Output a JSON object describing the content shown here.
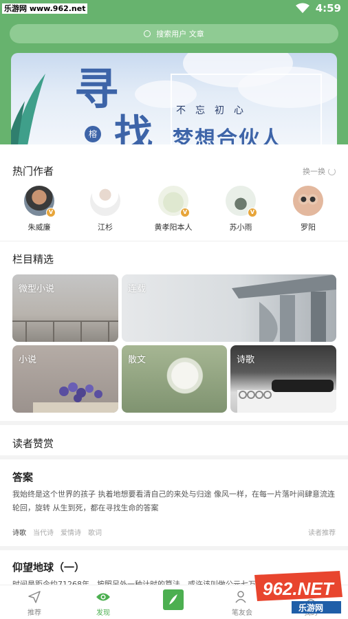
{
  "status_bar": {
    "site_label": "乐游网 www.962.net",
    "time": "4:59"
  },
  "search": {
    "placeholder": "搜索用户 文章"
  },
  "banner": {
    "big_char_1": "寻",
    "big_char_2": "找",
    "small_text": "不忘初心",
    "main_text": "梦想合伙人",
    "badge": "榕"
  },
  "hot_authors": {
    "title": "热门作者",
    "refresh_label": "换一换",
    "authors": [
      {
        "name": "朱威廉",
        "verified": true
      },
      {
        "name": "江杉",
        "verified": false
      },
      {
        "name": "黄孝阳本人",
        "verified": true
      },
      {
        "name": "苏小雨",
        "verified": true
      },
      {
        "name": "罗阳",
        "verified": false
      }
    ]
  },
  "columns": {
    "title": "栏目精选",
    "tiles": [
      {
        "label": "微型小说"
      },
      {
        "label": "连载"
      },
      {
        "label": "小说"
      },
      {
        "label": "散文"
      },
      {
        "label": "诗歌"
      }
    ]
  },
  "reader_appreciation": {
    "title": "读者赞赏"
  },
  "articles": [
    {
      "title": "答案",
      "body": "我始终是这个世界的孩子 执着地想要看清自己的来处与归途 像风一样，在每一片落叶间肆意流连 轮回，旋转 从生到死，都在寻找生命的答案",
      "tags": [
        "诗歌",
        "当代诗",
        "爱情诗",
        "歌词"
      ],
      "recommend": "读者推荐"
    },
    {
      "title": "仰望地球（一）",
      "body": "时间是距今约71268年，按照另外一种计时的算法，或许该叫做公元七万年吧，只是这种说"
    }
  ],
  "bottom_nav": [
    {
      "label": "推荐",
      "icon": "send-icon",
      "active": false
    },
    {
      "label": "发现",
      "icon": "eye-icon",
      "active": true
    },
    {
      "label": "",
      "icon": "write-icon",
      "active": false
    },
    {
      "label": "笔友会",
      "icon": "users-icon",
      "active": false
    },
    {
      "label": "我的",
      "icon": "user-icon",
      "active": false
    }
  ],
  "watermark": {
    "text": "962.NET",
    "sub": "乐游网"
  },
  "colors": {
    "brand_green": "#67b36e",
    "search_bg": "#8fcb93",
    "accent_active": "#4caf50",
    "badge_gold": "#e7a53a"
  }
}
